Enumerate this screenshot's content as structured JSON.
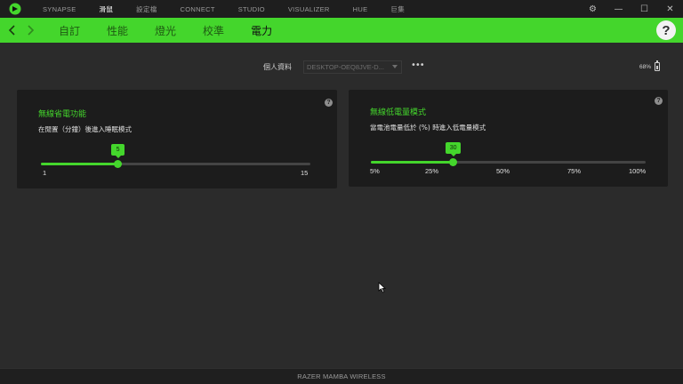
{
  "topnav": {
    "items": [
      {
        "label": "SYNAPSE",
        "active": false
      },
      {
        "label": "滑鼠",
        "active": true
      },
      {
        "label": "設定檔",
        "active": false
      },
      {
        "label": "CONNECT",
        "active": false
      },
      {
        "label": "STUDIO",
        "active": false
      },
      {
        "label": "VISUALIZER",
        "active": false
      },
      {
        "label": "HUE",
        "active": false
      },
      {
        "label": "巨集",
        "active": false
      }
    ]
  },
  "window_controls": {
    "settings": "⚙",
    "minimize": "—",
    "maximize": "☐",
    "close": "✕"
  },
  "subnav": {
    "items": [
      {
        "label": "自訂",
        "active": false
      },
      {
        "label": "性能",
        "active": false
      },
      {
        "label": "燈光",
        "active": false
      },
      {
        "label": "校準",
        "active": false
      },
      {
        "label": "電力",
        "active": true
      }
    ],
    "help": "?"
  },
  "profile": {
    "label": "個人資料",
    "selected": "DESKTOP-OEQ8JVE-D...",
    "more": "•••"
  },
  "battery": {
    "percent_text": "68%",
    "level": 0.68
  },
  "sleep_card": {
    "title": "無線省電功能",
    "description": "在閒置（分鐘）後進入睡眠模式",
    "help": "?",
    "slider": {
      "value": 5,
      "min": 1,
      "max": 15,
      "value_label": "5",
      "min_label": "1",
      "max_label": "15"
    }
  },
  "low_power_card": {
    "title": "無線低電量模式",
    "description": "當電池電量低於 (%) 時進入低電量模式",
    "help": "?",
    "slider": {
      "value": 30,
      "value_label": "30",
      "ticks": [
        "5%",
        "25%",
        "50%",
        "75%",
        "100%"
      ]
    }
  },
  "statusbar": {
    "device": "RAZER MAMBA WIRELESS"
  },
  "colors": {
    "accent": "#44d62c",
    "background": "#2b2b2b",
    "card": "#1c1c1c"
  }
}
